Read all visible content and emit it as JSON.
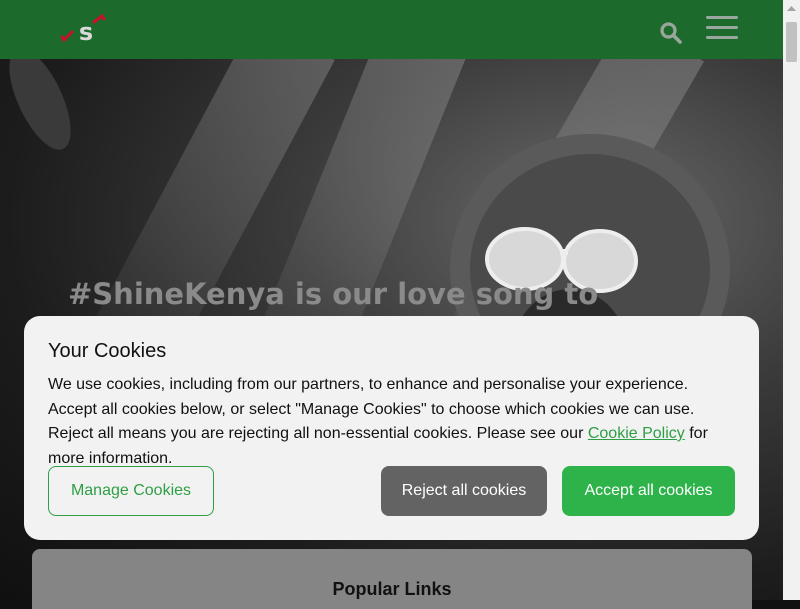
{
  "header": {
    "logo_icon": "safaricom-logo-icon",
    "search_icon": "search-icon",
    "menu_icon": "hamburger-menu-icon",
    "brand_color": "#1c6b2d"
  },
  "hero": {
    "headline": "#ShineKenya is our love song to"
  },
  "cookie_banner": {
    "title": "Your Cookies",
    "body_before_link": "We use cookies, including from our partners, to enhance and personalise your experience. Accept all cookies below, or select \"Manage Cookies\" to choose which cookies we can use. Reject all means you are rejecting all non-essential cookies. Please see our ",
    "link_text": "Cookie Policy",
    "body_after_link": " for more information.",
    "manage_label": "Manage Cookies",
    "reject_label": "Reject all cookies",
    "accept_label": "Accept all cookies",
    "accent_color": "#2db34a"
  },
  "popular_links": {
    "title": "Popular Links"
  }
}
